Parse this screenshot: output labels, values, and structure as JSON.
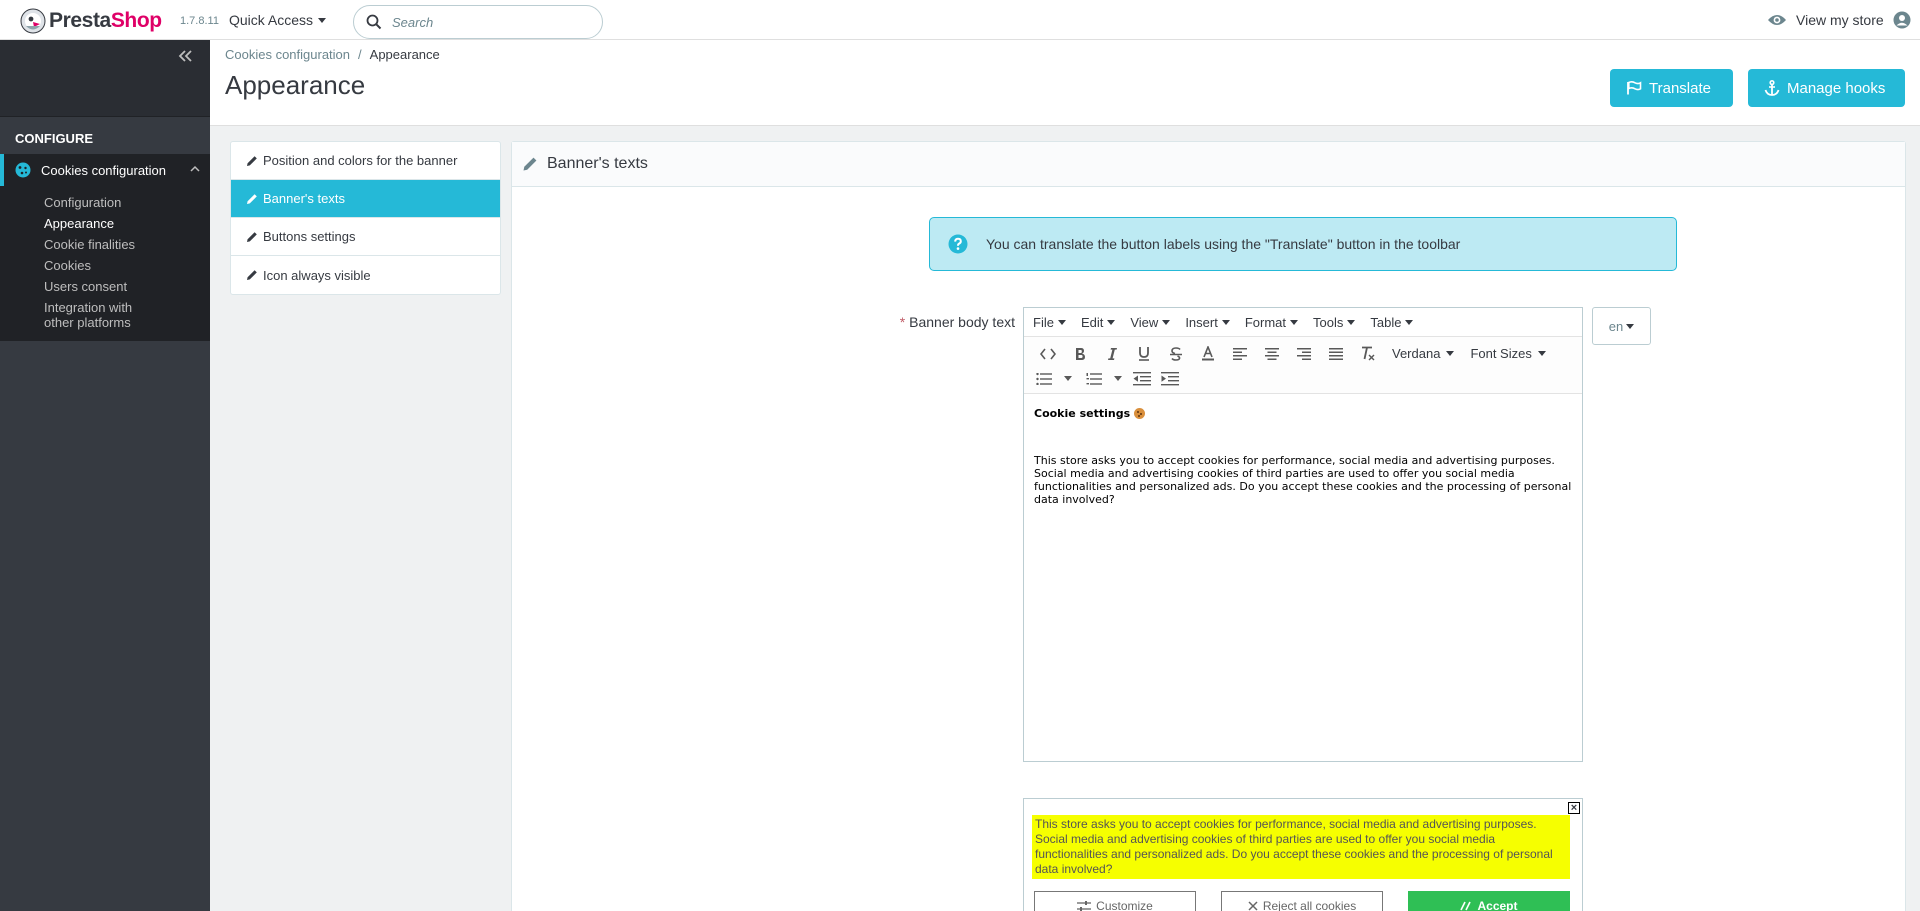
{
  "header": {
    "logo_part1": "Presta",
    "logo_part2": "Shop",
    "version": "1.7.8.11",
    "quick_access": "Quick Access",
    "search_placeholder": "Search",
    "view_store": "View my store"
  },
  "sidebar": {
    "section_title": "CONFIGURE",
    "active_menu": "Cookies configuration",
    "submenu": [
      {
        "label": "Configuration"
      },
      {
        "label": "Appearance"
      },
      {
        "label": "Cookie finalities"
      },
      {
        "label": "Cookies"
      },
      {
        "label": "Users consent"
      },
      {
        "label": "Integration with other platforms"
      }
    ],
    "active_submenu": "Appearance"
  },
  "page": {
    "breadcrumb_parent": "Cookies configuration",
    "breadcrumb_sep": "/",
    "breadcrumb_current": "Appearance",
    "title": "Appearance",
    "translate_button": "Translate",
    "manage_hooks_button": "Manage hooks"
  },
  "tabs": [
    {
      "label": "Position and colors for the banner"
    },
    {
      "label": "Banner's texts"
    },
    {
      "label": "Buttons settings"
    },
    {
      "label": "Icon always visible"
    }
  ],
  "active_tab": "Banner's texts",
  "panel": {
    "title": "Banner's texts",
    "info_alert": "You can translate the button labels using the \"Translate\" button in the toolbar",
    "field_label": "Banner body text",
    "required_mark": "*",
    "language": "en"
  },
  "editor": {
    "menus": [
      "File",
      "Edit",
      "View",
      "Insert",
      "Format",
      "Tools",
      "Table"
    ],
    "font_family": "Verdana",
    "font_sizes": "Font Sizes",
    "heading": "Cookie settings",
    "body": "This store asks you to accept cookies for performance, social media and advertising purposes. Social media and advertising cookies of third parties are used to offer you social media functionalities and personalized ads. Do you accept these cookies and the processing of personal data involved?"
  },
  "preview": {
    "close": "×",
    "text": "This store asks you to accept cookies for performance, social media and advertising purposes. Social media and advertising cookies of third parties are used to offer you social media functionalities and personalized ads. Do you accept these cookies and the processing of personal data involved?",
    "customize_button": "Customize",
    "reject_button": "Reject all cookies",
    "accept_button": "Accept"
  },
  "colors": {
    "accent": "#25b9d7",
    "brand_pink": "#df0067",
    "sidebar_bg": "#363a41",
    "highlight": "#f6ff00",
    "accept_green": "#2fbf55"
  }
}
